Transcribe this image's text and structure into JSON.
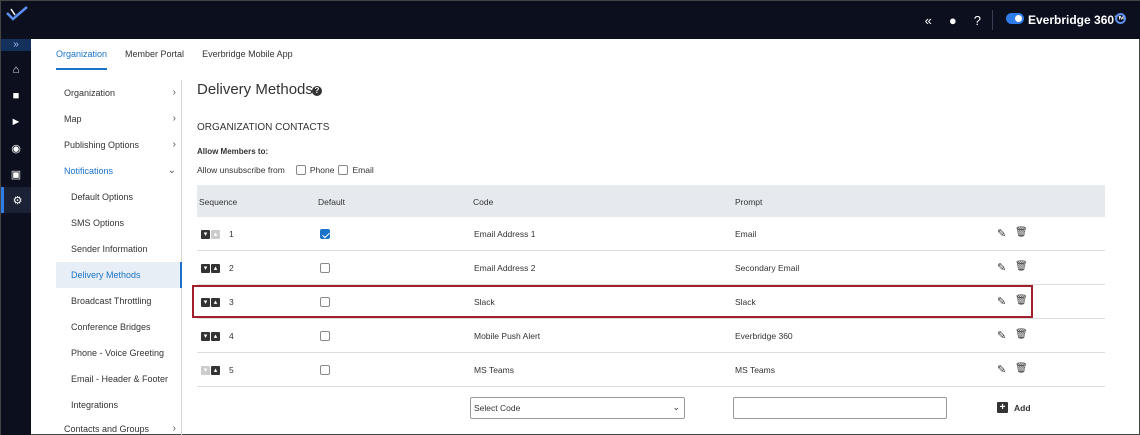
{
  "topbar": {
    "icons": [
      "collapse-icon",
      "user-icon",
      "help-icon"
    ],
    "brand": "Everbridge 360™",
    "accent_color": "#2f7be8"
  },
  "rail": {
    "expand": "»",
    "items": [
      "home-icon",
      "contacts-icon",
      "megaphone-icon",
      "map-pin-icon",
      "reports-icon",
      "settings-icon"
    ]
  },
  "tabs": [
    {
      "label": "Organization"
    },
    {
      "label": "Member Portal"
    },
    {
      "label": "Everbridge Mobile App"
    }
  ],
  "nav": {
    "items": [
      {
        "label": "Organization"
      },
      {
        "label": "Map"
      },
      {
        "label": "Publishing Options"
      },
      {
        "label": "Notifications"
      },
      {
        "label": "Default Options"
      },
      {
        "label": "SMS Options"
      },
      {
        "label": "Sender Information"
      },
      {
        "label": "Delivery Methods"
      },
      {
        "label": "Broadcast Throttling"
      },
      {
        "label": "Conference Bridges"
      },
      {
        "label": "Phone - Voice Greeting"
      },
      {
        "label": "Email - Header & Footer"
      },
      {
        "label": "Integrations"
      },
      {
        "label": "Contacts and Groups"
      }
    ]
  },
  "page": {
    "title": "Delivery Methods",
    "section": "ORGANIZATION CONTACTS",
    "allow_label": "Allow Members to:",
    "unsubscribe_label": "Allow unsubscribe from",
    "phone_label": "Phone",
    "email_label": "Email"
  },
  "table": {
    "headers": [
      "Sequence",
      "Default",
      "Code",
      "Prompt"
    ],
    "rows": [
      {
        "seq": "1",
        "default": true,
        "code": "Email Address 1",
        "prompt": "Email"
      },
      {
        "seq": "2",
        "default": false,
        "code": "Email Address 2",
        "prompt": "Secondary Email"
      },
      {
        "seq": "3",
        "default": false,
        "code": "Slack",
        "prompt": "Slack"
      },
      {
        "seq": "4",
        "default": false,
        "code": "Mobile Push Alert",
        "prompt": "Everbridge 360"
      },
      {
        "seq": "5",
        "default": false,
        "code": "MS Teams",
        "prompt": "MS Teams"
      }
    ]
  },
  "add_row": {
    "select_value": "Select Code",
    "add_label": "Add"
  }
}
